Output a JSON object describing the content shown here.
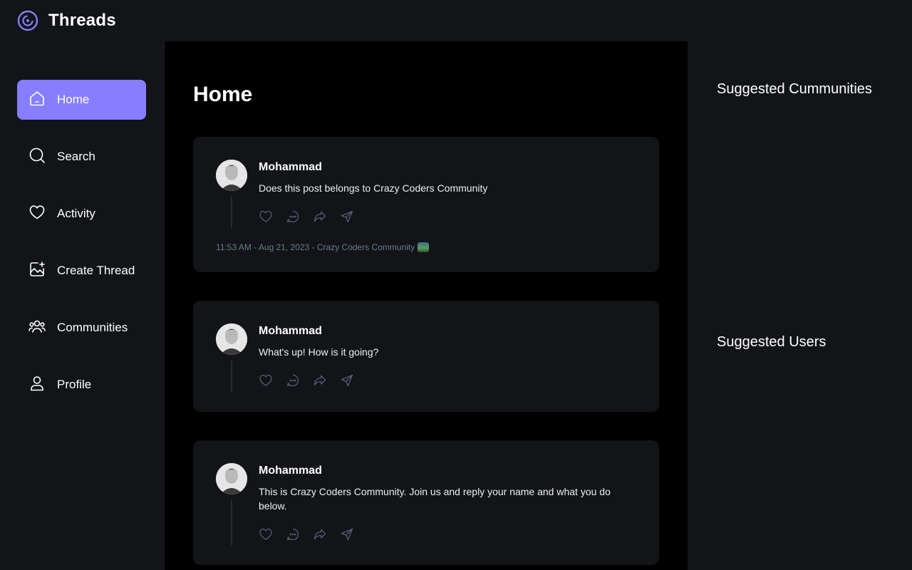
{
  "app": {
    "title": "Threads",
    "accent": "#877EFF"
  },
  "nav": {
    "items": [
      {
        "label": "Home",
        "icon": "home-icon",
        "active": true
      },
      {
        "label": "Search",
        "icon": "search-icon"
      },
      {
        "label": "Activity",
        "icon": "heart-icon"
      },
      {
        "label": "Create Thread",
        "icon": "create-image-icon"
      },
      {
        "label": "Communities",
        "icon": "community-icon"
      },
      {
        "label": "Profile",
        "icon": "user-icon"
      }
    ]
  },
  "main": {
    "title": "Home",
    "threads": [
      {
        "author": "Mohammad",
        "content": "Does this post belongs to Crazy Coders Community",
        "meta": "11:53 AM - Aug 21, 2023 - Crazy Coders Community"
      },
      {
        "author": "Mohammad",
        "content": "What's up! How is it going?"
      },
      {
        "author": "Mohammad",
        "content": "This is Crazy Coders Community. Join us and reply your name and what you do below."
      }
    ]
  },
  "right": {
    "suggested_communities": "Suggested Cummunities",
    "suggested_users": "Suggested Users"
  }
}
